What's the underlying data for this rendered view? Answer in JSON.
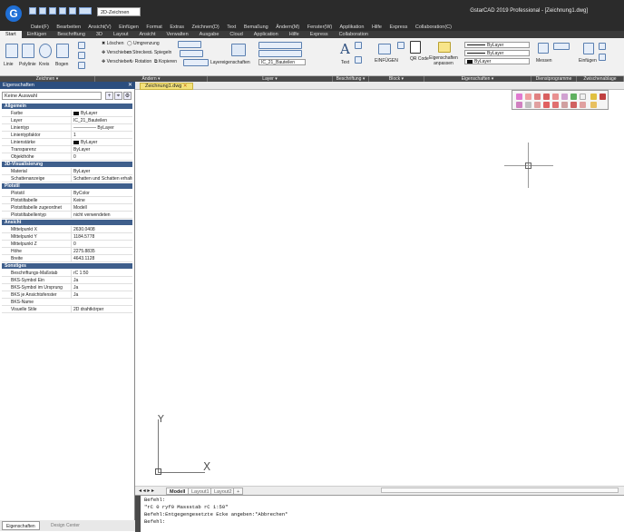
{
  "titlebar": {
    "logo": "G",
    "workspace": "2D-Zeichnen",
    "title": "GstarCAD 2019 Professional - [Zeichnung1.dwg]"
  },
  "menu": [
    "Datei(F)",
    "Bearbeiten",
    "Ansicht(V)",
    "Einfügen",
    "Format",
    "Extras",
    "Zeichnen(D)",
    "Text",
    "Bemaßung",
    "Ändern(M)",
    "Fenster(W)",
    "Applikation",
    "Hilfe",
    "Express",
    "Collaboration(C)"
  ],
  "tabs": {
    "items": [
      "Start",
      "Einfügen",
      "Beschriftung",
      "3D",
      "Layout",
      "Ansicht",
      "Verwalten",
      "Ausgabe",
      "Cloud",
      "Application",
      "Hilfe",
      "Express",
      "Collaboration"
    ],
    "active": "Start"
  },
  "ribbon": {
    "groups": [
      "Zeichnen ▾",
      "Ändern ▾",
      "Layer ▾",
      "Beschriftung ▾",
      "Block ▾",
      "Eigenschaften ▾",
      "Dienstprogramme",
      "Zwischenablage"
    ],
    "draw_tools": [
      "Linie",
      "Polylinie",
      "Kreis",
      "Bogen"
    ],
    "modify_tools": [
      "Löschen",
      "Umgrenzung",
      "Verschieben",
      "Strecken",
      "Spiegeln",
      "Verschieben",
      "Rotation",
      "Kopieren"
    ],
    "layer_props_label": "Layereigenschaften",
    "layer_combo": "IC_21_Bauteilen",
    "text_label": "Text",
    "insert_label": "EINFÜGEN",
    "qr_label": "QR Code",
    "props_label": "Eigenschaften anpassen",
    "bylayer": "ByLayer",
    "measure_label": "Messen",
    "paste_label": "Einfügen"
  },
  "properties": {
    "title": "Eigenschaften",
    "selection": "Keine Auswahl",
    "sections": [
      {
        "name": "Allgemein",
        "rows": [
          {
            "k": "Farbe",
            "v": "ByLayer",
            "swatch": true
          },
          {
            "k": "Layer",
            "v": "IC_21_Bauteilen"
          },
          {
            "k": "Linientyp",
            "v": "————— ByLayer"
          },
          {
            "k": "Linientypfaktor",
            "v": "1"
          },
          {
            "k": "Linienstärke",
            "v": "ByLayer",
            "swatch": true
          },
          {
            "k": "Transparenz",
            "v": "ByLayer"
          },
          {
            "k": "Objekthöhe",
            "v": "0"
          }
        ]
      },
      {
        "name": "3D-Visualisierung",
        "rows": [
          {
            "k": "Material",
            "v": "ByLayer"
          },
          {
            "k": "Schattenanzeige",
            "v": "Schatten und Schatten erhalten"
          }
        ]
      },
      {
        "name": "Plotstil",
        "rows": [
          {
            "k": "Plotstil",
            "v": "ByColor"
          },
          {
            "k": "Plotstiltabelle",
            "v": "Keine"
          },
          {
            "k": "Plotstiltabelle zugeordnet",
            "v": "Modell"
          },
          {
            "k": "Plotstiltabellentyp",
            "v": "nicht verwendeten"
          }
        ]
      },
      {
        "name": "Ansicht",
        "rows": [
          {
            "k": "Mittelpunkt X",
            "v": "2630.0408"
          },
          {
            "k": "Mittelpunkt Y",
            "v": "1184.5778"
          },
          {
            "k": "Mittelpunkt Z",
            "v": "0"
          },
          {
            "k": "Höhe",
            "v": "2275.8835"
          },
          {
            "k": "Breite",
            "v": "4643.1128"
          }
        ]
      },
      {
        "name": "Sonstiges",
        "rows": [
          {
            "k": "Beschriftungs-Maßstab",
            "v": "rC 1:50"
          },
          {
            "k": "BKS-Symbol Ein",
            "v": "Ja"
          },
          {
            "k": "BKS-Symbol im Ursprung",
            "v": "Ja"
          },
          {
            "k": "BKS je Ansichtsfenster",
            "v": "Ja"
          },
          {
            "k": "BKS-Name",
            "v": ""
          },
          {
            "k": "Visuelle Stile",
            "v": "2D drahtkörper"
          }
        ]
      }
    ],
    "bottom_tabs": [
      "Eigenschaften",
      "Design Center"
    ]
  },
  "document": {
    "tab": "Zeichnung1.dwg",
    "layout_tabs": [
      "Modell",
      "Layout1",
      "Layout2"
    ]
  },
  "ucs": {
    "y": "Y",
    "x": "X"
  },
  "command_line": [
    "Befehl:",
    "\"rC 0 ryf0   Massstab rC 1:50\"",
    "Befehl:Entgegengesetzte Ecke angeben:*Abbrechen*",
    "Befehl:"
  ],
  "colors": {
    "accent": "#2c4e7e",
    "titlebar": "#2b2b2b",
    "doc_tab": "#f4e27a"
  }
}
